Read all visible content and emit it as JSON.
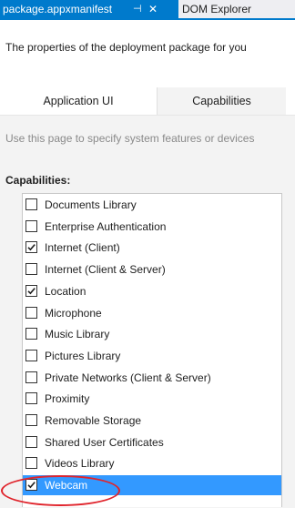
{
  "tabs": {
    "active_label": "package.appxmanifest",
    "pin_glyph": "⊣",
    "close_glyph": "✕",
    "inactive_label": "DOM Explorer"
  },
  "description": "The properties of the deployment package for you",
  "page_tabs": [
    "Application UI",
    "Capabilities"
  ],
  "hint": "Use this page to specify system features or devices",
  "capabilities": {
    "title": "Capabilities:",
    "items": [
      {
        "label": "Documents Library",
        "checked": false,
        "selected": false
      },
      {
        "label": "Enterprise Authentication",
        "checked": false,
        "selected": false
      },
      {
        "label": "Internet (Client)",
        "checked": true,
        "selected": false
      },
      {
        "label": "Internet (Client & Server)",
        "checked": false,
        "selected": false
      },
      {
        "label": "Location",
        "checked": true,
        "selected": false
      },
      {
        "label": "Microphone",
        "checked": false,
        "selected": false
      },
      {
        "label": "Music Library",
        "checked": false,
        "selected": false
      },
      {
        "label": "Pictures Library",
        "checked": false,
        "selected": false
      },
      {
        "label": "Private Networks (Client & Server)",
        "checked": false,
        "selected": false
      },
      {
        "label": "Proximity",
        "checked": false,
        "selected": false
      },
      {
        "label": "Removable Storage",
        "checked": false,
        "selected": false
      },
      {
        "label": "Shared User Certificates",
        "checked": false,
        "selected": false
      },
      {
        "label": "Videos Library",
        "checked": false,
        "selected": false
      },
      {
        "label": "Webcam",
        "checked": true,
        "selected": true
      }
    ]
  },
  "colors": {
    "accent": "#007acc",
    "selection": "#3399ff",
    "highlight_circle": "#e0242c"
  }
}
